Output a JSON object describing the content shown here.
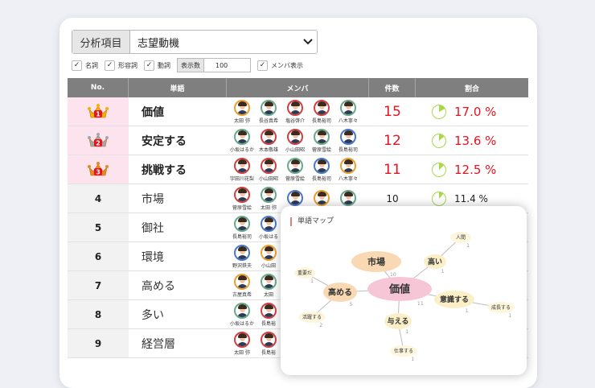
{
  "select": {
    "label": "分析項目",
    "value": "志望動機"
  },
  "options": {
    "noun": "名詞",
    "adjective": "形容詞",
    "verb": "動詞",
    "display_label": "表示数",
    "display_value": "100",
    "show_members": "メンバ表示"
  },
  "headers": {
    "no": "No.",
    "word": "単語",
    "members": "メンバ",
    "count": "件数",
    "ratio": "割合"
  },
  "rows": [
    {
      "no": "1",
      "word": "価値",
      "count": "15",
      "ratio": "17.0 %",
      "ratio_value": 0.17,
      "top": true,
      "members": [
        "太田 弥",
        "長谷真希",
        "塩谷啓介",
        "長島裕司",
        "八木寧々"
      ]
    },
    {
      "no": "2",
      "word": "安定する",
      "count": "12",
      "ratio": "13.6 %",
      "ratio_value": 0.136,
      "top": true,
      "members": [
        "小坂はるか",
        "木本敬雄",
        "小山田昭",
        "菅原雪絵",
        "長島裕司"
      ]
    },
    {
      "no": "3",
      "word": "挑戦する",
      "count": "11",
      "ratio": "12.5 %",
      "ratio_value": 0.125,
      "top": true,
      "members": [
        "宇田川花梨",
        "小山田昭",
        "菅原雪絵",
        "長島裕司",
        "八木寧々"
      ]
    },
    {
      "no": "4",
      "word": "市場",
      "count": "10",
      "ratio": "11.4 %",
      "ratio_value": 0.114,
      "top": false,
      "members": [
        "菅原雪絵",
        "太田 弥",
        "",
        "",
        ""
      ]
    },
    {
      "no": "5",
      "word": "御社",
      "count": "",
      "ratio": "",
      "ratio_value": null,
      "top": false,
      "members": [
        "長島裕司",
        "小坂はる"
      ]
    },
    {
      "no": "6",
      "word": "環境",
      "count": "",
      "ratio": "",
      "ratio_value": null,
      "top": false,
      "members": [
        "野沢鉄夫",
        "小山田"
      ]
    },
    {
      "no": "7",
      "word": "高める",
      "count": "",
      "ratio": "",
      "ratio_value": null,
      "top": false,
      "members": [
        "古屋真希",
        "太田"
      ]
    },
    {
      "no": "8",
      "word": "多い",
      "count": "",
      "ratio": "",
      "ratio_value": null,
      "top": false,
      "members": [
        "小坂はるか",
        "長島裕"
      ]
    },
    {
      "no": "9",
      "word": "経営層",
      "count": "",
      "ratio": "",
      "ratio_value": null,
      "top": false,
      "members": [
        "太田 弥",
        "長島裕"
      ]
    }
  ],
  "word_map": {
    "title": "単語マップ",
    "nodes": [
      {
        "id": "kachi",
        "label": "価値",
        "count": "11"
      },
      {
        "id": "shijo",
        "label": "市場",
        "count": "10"
      },
      {
        "id": "takai",
        "label": "高い",
        "count": "1"
      },
      {
        "id": "ningen",
        "label": "人間",
        "count": "1"
      },
      {
        "id": "takameru",
        "label": "高める",
        "count": "5"
      },
      {
        "id": "juyo",
        "label": "重要だ",
        "count": "1"
      },
      {
        "id": "katsuyaku",
        "label": "活躍する",
        "count": "2"
      },
      {
        "id": "ishiki",
        "label": "意識する",
        "count": "1"
      },
      {
        "id": "seicho",
        "label": "成長する",
        "count": "1"
      },
      {
        "id": "ataeru",
        "label": "与える",
        "count": "1"
      },
      {
        "id": "shigoto",
        "label": "仕事する",
        "count": "1"
      }
    ]
  },
  "colors": {
    "header_bg": "#7f7f7f",
    "top_red": "#e8121f",
    "pie_green": "#a8d84a",
    "rank_bg": "#fde3ee",
    "crown_gold": "#f0b400"
  }
}
